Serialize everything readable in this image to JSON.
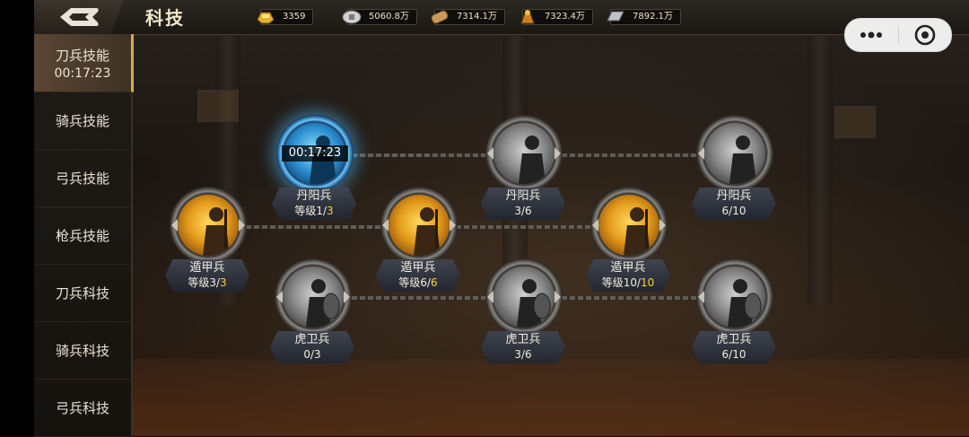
{
  "topbar": {
    "title": "科技",
    "resources": [
      {
        "icon": "gold-ingot-icon",
        "value": "3359"
      },
      {
        "icon": "silver-coin-icon",
        "value": "5060.8万"
      },
      {
        "icon": "wood-log-icon",
        "value": "7314.1万"
      },
      {
        "icon": "grain-sack-icon",
        "value": "7323.4万"
      },
      {
        "icon": "iron-ingot-icon",
        "value": "7892.1万"
      }
    ]
  },
  "tabs": [
    {
      "label": "刀兵技能",
      "timer": "00:17:23",
      "active": true
    },
    {
      "label": "骑兵技能"
    },
    {
      "label": "弓兵技能"
    },
    {
      "label": "枪兵技能"
    },
    {
      "label": "刀兵科技"
    },
    {
      "label": "骑兵科技"
    },
    {
      "label": "弓兵科技"
    }
  ],
  "nodes": {
    "dunjia1": {
      "name": "遁甲兵",
      "level_prefix": "等级",
      "current": "3",
      "sep": "/",
      "max": "3"
    },
    "danyang1": {
      "name": "丹阳兵",
      "level_prefix": "等级",
      "current": "1",
      "sep": "/",
      "max": "3",
      "timer": "00:17:23"
    },
    "huwei1": {
      "name": "虎卫兵",
      "level_prefix": "",
      "current": "0",
      "sep": "/",
      "max": "3"
    },
    "dunjia2": {
      "name": "遁甲兵",
      "level_prefix": "等级",
      "current": "6",
      "sep": "/",
      "max": "6"
    },
    "danyang2": {
      "name": "丹阳兵",
      "level_prefix": "",
      "current": "3",
      "sep": "/",
      "max": "6"
    },
    "huwei2": {
      "name": "虎卫兵",
      "level_prefix": "",
      "current": "3",
      "sep": "/",
      "max": "6"
    },
    "dunjia3": {
      "name": "遁甲兵",
      "level_prefix": "等级",
      "current": "10",
      "sep": "/",
      "max": "10"
    },
    "danyang3": {
      "name": "丹阳兵",
      "level_prefix": "",
      "current": "6",
      "sep": "/",
      "max": "10"
    },
    "huwei3": {
      "name": "虎卫兵",
      "level_prefix": "",
      "current": "6",
      "sep": "/",
      "max": "10"
    }
  },
  "colors": {
    "accent_gold": "#f4d23c",
    "active_blue": "#2b8fd0"
  }
}
